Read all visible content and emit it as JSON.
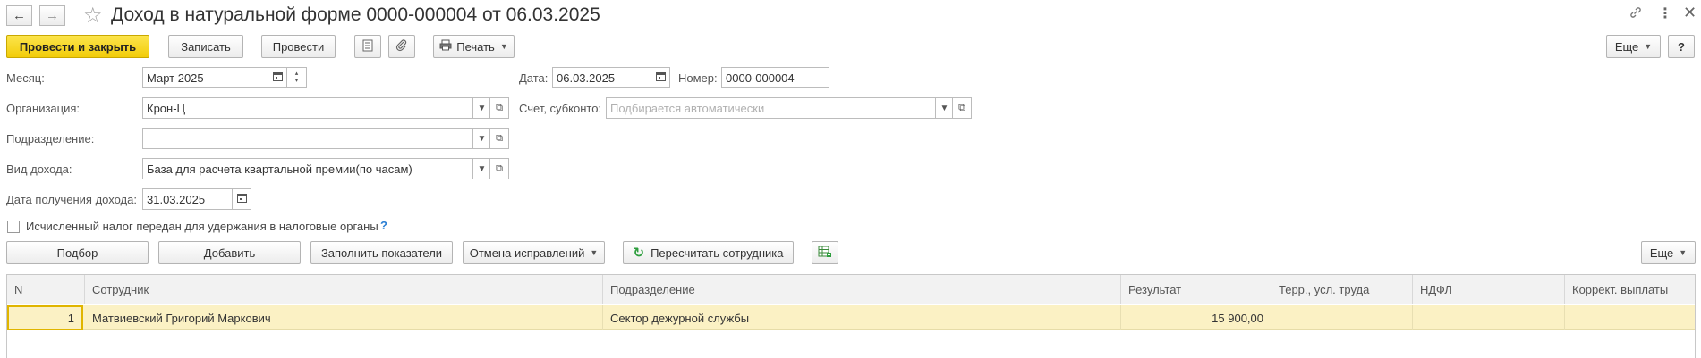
{
  "title": "Доход в натуральной форме 0000-000004 от 06.03.2025",
  "nav": {
    "back_icon": "arrow-left-icon",
    "forward_icon": "arrow-right-icon",
    "favorite_icon": "star-icon"
  },
  "title_icons": {
    "link": "link-icon",
    "menu": "more-icon",
    "close": "close-icon"
  },
  "toolbar": {
    "post_close": "Провести и закрыть",
    "save": "Записать",
    "post": "Провести",
    "print": "Печать",
    "more": "Еще",
    "help": "?"
  },
  "form": {
    "month_label": "Месяц:",
    "month_value": "Март 2025",
    "date_label": "Дата:",
    "date_value": "06.03.2025",
    "number_label": "Номер:",
    "number_value": "0000-000004",
    "org_label": "Организация:",
    "org_value": "Крон-Ц",
    "account_label": "Счет, субконто:",
    "account_placeholder": "Подбирается автоматически",
    "dept_label": "Подразделение:",
    "dept_value": "",
    "income_type_label": "Вид дохода:",
    "income_type_value": "База для расчета квартальной премии(по часам)",
    "income_date_label": "Дата получения дохода:",
    "income_date_value": "31.03.2025",
    "tax_checkbox_label": "Исчисленный налог передан для удержания в налоговые органы",
    "tax_checkbox_checked": false,
    "help_mark": "?"
  },
  "table_toolbar": {
    "select": "Подбор",
    "add": "Добавить",
    "fill": "Заполнить показатели",
    "cancel_corrections": "Отмена исправлений",
    "recalc": "Пересчитать сотрудника",
    "more": "Еще"
  },
  "table": {
    "columns": [
      "N",
      "Сотрудник",
      "Подразделение",
      "Результат",
      "Терр., усл. труда",
      "НДФЛ",
      "Коррект. выплаты"
    ],
    "rows": [
      {
        "n": "1",
        "employee": "Матвиевский Григорий Маркович",
        "department": "Сектор дежурной службы",
        "result": "15 900,00",
        "terr": "",
        "ndfl": "",
        "correction": ""
      }
    ]
  },
  "colors": {
    "primary_button": "#f5d31c",
    "selected_row": "#fbf1c4",
    "recalc_icon": "#2e9e3e"
  }
}
